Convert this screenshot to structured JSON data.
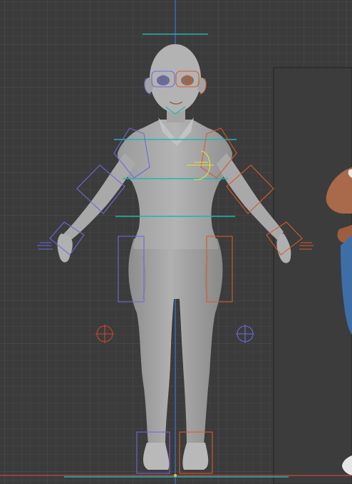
{
  "app": {
    "name": "3D viewport"
  },
  "viewport": {
    "mode": "rig-overlay",
    "colors": {
      "background": "#3b3b3b",
      "grid_major": "#454545",
      "grid_minor": "#414141",
      "axis_z": "#3a6fd8",
      "axis_x": "#c8463f",
      "center_line": "#21b5b0",
      "bone_left": "#d85a2a",
      "bone_right": "#6c6ad8",
      "bone_active": "#e8e03a",
      "mesh": "#a7a7a7",
      "reference_skin": "#a86a4a",
      "reference_jeans": "#3d6ea8"
    },
    "icons": [
      "mesh-body",
      "bone-controls",
      "ik-target",
      "reference-image"
    ]
  }
}
